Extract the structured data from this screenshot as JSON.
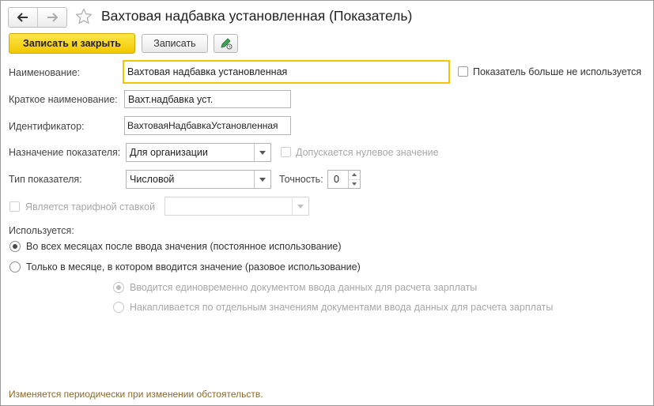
{
  "window": {
    "title": "Вахтовая надбавка установленная (Показатель)",
    "nav_back_icon": "arrow-left-icon",
    "nav_forward_icon": "arrow-right-icon",
    "favorite_icon": "star-icon"
  },
  "toolbar": {
    "save_close_label": "Записать и закрыть",
    "save_label": "Записать",
    "edit_icon": "pencil-settings-icon"
  },
  "form": {
    "name_label": "Наименование:",
    "name_value": "Вахтовая надбавка установленная",
    "not_used_label": "Показатель больше не используется",
    "short_name_label": "Краткое наименование:",
    "short_name_value": "Вахт.надбавка уст.",
    "identifier_label": "Идентификатор:",
    "identifier_value": "ВахтоваяНадбавкаУстановленная",
    "purpose_label": "Назначение показателя:",
    "purpose_value": "Для организации",
    "zero_allowed_label": "Допускается нулевое значение",
    "type_label": "Тип показателя:",
    "type_value": "Числовой",
    "precision_label": "Точность:",
    "precision_value": "0",
    "tariff_label": "Является тарифной ставкой",
    "tariff_value": "",
    "usage_label": "Используется:",
    "usage_option_permanent": "Во всех месяцах после ввода значения (постоянное использование)",
    "usage_option_once": "Только в месяце, в котором вводится значение (разовое использование)",
    "sub_option_single_doc": "Вводится единовременно документом ввода данных для расчета зарплаты",
    "sub_option_accumulate": "Накапливается по отдельным значениям документами ввода данных для расчета зарплаты"
  },
  "footer": {
    "note": "Изменяется периодически при изменении обстоятельств."
  },
  "colors": {
    "primary_button": "#f2c600",
    "focus_border": "#f2c600",
    "footer_text": "#8a6a2a"
  }
}
